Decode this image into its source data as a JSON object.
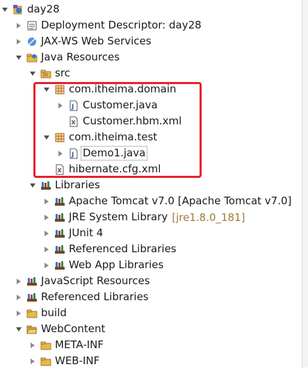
{
  "tree": {
    "project": {
      "label": "day28",
      "icon": "project-icon"
    },
    "deployment_descriptor": {
      "label": "Deployment Descriptor: day28",
      "icon": "deployment-descriptor-icon"
    },
    "jaxws": {
      "label": "JAX-WS Web Services",
      "icon": "web-services-icon"
    },
    "java_resources": {
      "label": "Java Resources",
      "icon": "java-resources-icon"
    },
    "src": {
      "label": "src",
      "icon": "source-folder-icon"
    },
    "pkg_domain": {
      "label": "com.itheima.domain",
      "icon": "package-icon"
    },
    "customer_java": {
      "label": "Customer.java",
      "icon": "java-file-icon"
    },
    "customer_hbm": {
      "label": "Customer.hbm.xml",
      "icon": "xml-file-icon"
    },
    "pkg_test": {
      "label": "com.itheima.test",
      "icon": "package-icon"
    },
    "demo1": {
      "label": "Demo1.java",
      "icon": "java-file-icon"
    },
    "hibernate_cfg": {
      "label": "hibernate.cfg.xml",
      "icon": "xml-file-icon"
    },
    "libraries": {
      "label": "Libraries",
      "icon": "library-icon"
    },
    "tomcat": {
      "label": "Apache Tomcat v7.0 [Apache Tomcat v7.0]",
      "icon": "library-icon"
    },
    "jre": {
      "label": "JRE System Library",
      "decoration": "[jre1.8.0_181]",
      "icon": "library-icon"
    },
    "junit": {
      "label": "JUnit 4",
      "icon": "library-icon"
    },
    "referenced_libs_inner": {
      "label": "Referenced Libraries",
      "icon": "library-icon"
    },
    "webapp_libs": {
      "label": "Web App Libraries",
      "icon": "library-icon"
    },
    "js_resources": {
      "label": "JavaScript Resources",
      "icon": "library-icon"
    },
    "referenced_libs": {
      "label": "Referenced Libraries",
      "icon": "library-icon"
    },
    "build": {
      "label": "build",
      "icon": "folder-icon"
    },
    "webcontent": {
      "label": "WebContent",
      "icon": "folder-open-icon"
    },
    "meta_inf": {
      "label": "META-INF",
      "icon": "folder-icon"
    },
    "web_inf": {
      "label": "WEB-INF",
      "icon": "folder-icon"
    }
  },
  "colors": {
    "highlight_border": "#e8202c",
    "decoration_text": "#9c7d3a",
    "package_icon": "#b5651d",
    "folder_icon": "#e8b84a"
  }
}
